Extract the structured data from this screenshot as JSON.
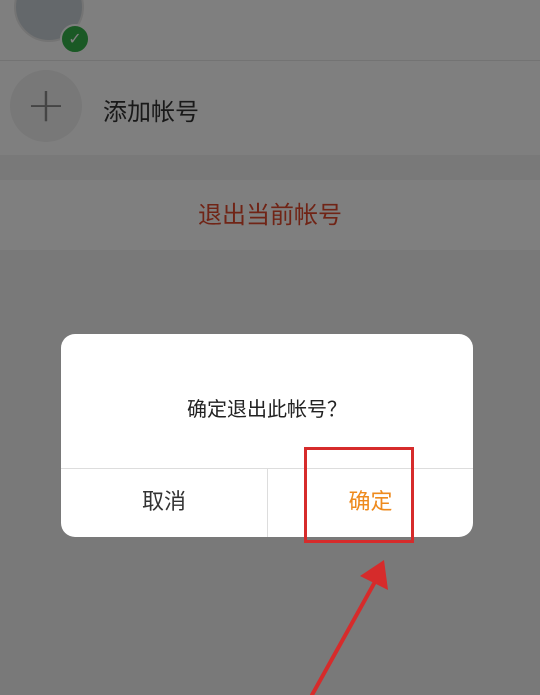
{
  "accounts": {
    "current_name": "",
    "add_label": "添加帐号"
  },
  "logout": {
    "label": "退出当前帐号",
    "color": "#e0492d"
  },
  "dialog": {
    "message": "确定退出此帐号？",
    "cancel_label": "取消",
    "confirm_label": "确定",
    "confirm_color": "#ee8a1d"
  },
  "icons": {
    "verified": "check-icon",
    "add": "plus-icon"
  },
  "annotation": {
    "color": "#d62b2b"
  }
}
